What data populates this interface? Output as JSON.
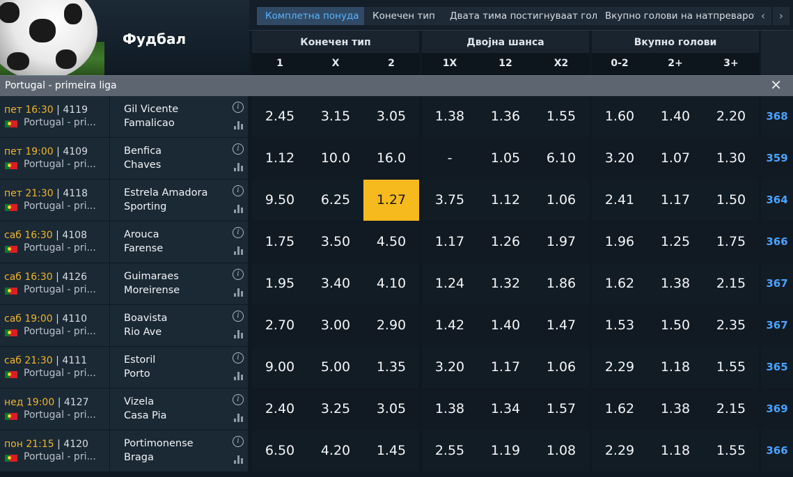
{
  "sport": {
    "title": "Фудбал"
  },
  "tabs": [
    {
      "label": "Комплетна понуда",
      "active": true
    },
    {
      "label": "Конечен тип",
      "active": false
    },
    {
      "label": "Двата тима постигнуваат гол",
      "active": false
    },
    {
      "label": "Вкупно голови на натпреварот",
      "active": false
    }
  ],
  "nav": {
    "prev": "‹",
    "next": "›"
  },
  "groups": [
    {
      "title": "Конечен тип",
      "cols": [
        "1",
        "X",
        "2"
      ]
    },
    {
      "title": "Двојна шанса",
      "cols": [
        "1X",
        "12",
        "X2"
      ]
    },
    {
      "title": "Вкупно голови",
      "cols": [
        "0-2",
        "2+",
        "3+"
      ]
    }
  ],
  "league": {
    "name": "Portugal - primeira liga",
    "close": "✕"
  },
  "colors": {
    "highlight": "#f7ba1e",
    "time": "#f0b52c",
    "more": "#4aa3ff"
  },
  "matches": [
    {
      "day": "пет 16:30",
      "code": "4119",
      "league": "Portugal - pri...",
      "home": "Gil Vicente",
      "away": "Famalicao",
      "odds": [
        "2.45",
        "3.15",
        "3.05",
        "1.38",
        "1.36",
        "1.55",
        "1.60",
        "1.40",
        "2.20"
      ],
      "more": "368",
      "highlight": -1
    },
    {
      "day": "пет 19:00",
      "code": "4109",
      "league": "Portugal - pri...",
      "home": "Benfica",
      "away": "Chaves",
      "odds": [
        "1.12",
        "10.0",
        "16.0",
        "-",
        "1.05",
        "6.10",
        "3.20",
        "1.07",
        "1.30"
      ],
      "more": "359",
      "highlight": -1
    },
    {
      "day": "пет 21:30",
      "code": "4118",
      "league": "Portugal - pri...",
      "home": "Estrela Amadora",
      "away": "Sporting",
      "odds": [
        "9.50",
        "6.25",
        "1.27",
        "3.75",
        "1.12",
        "1.06",
        "2.41",
        "1.17",
        "1.50"
      ],
      "more": "364",
      "highlight": 2
    },
    {
      "day": "саб 16:30",
      "code": "4108",
      "league": "Portugal - pri...",
      "home": "Arouca",
      "away": "Farense",
      "odds": [
        "1.75",
        "3.50",
        "4.50",
        "1.17",
        "1.26",
        "1.97",
        "1.96",
        "1.25",
        "1.75"
      ],
      "more": "366",
      "highlight": -1
    },
    {
      "day": "саб 16:30",
      "code": "4126",
      "league": "Portugal - pri...",
      "home": "Guimaraes",
      "away": "Moreirense",
      "odds": [
        "1.95",
        "3.40",
        "4.10",
        "1.24",
        "1.32",
        "1.86",
        "1.62",
        "1.38",
        "2.15"
      ],
      "more": "367",
      "highlight": -1
    },
    {
      "day": "саб 19:00",
      "code": "4110",
      "league": "Portugal - pri...",
      "home": "Boavista",
      "away": "Rio Ave",
      "odds": [
        "2.70",
        "3.00",
        "2.90",
        "1.42",
        "1.40",
        "1.47",
        "1.53",
        "1.50",
        "2.35"
      ],
      "more": "367",
      "highlight": -1
    },
    {
      "day": "саб 21:30",
      "code": "4111",
      "league": "Portugal - pri...",
      "home": "Estoril",
      "away": "Porto",
      "odds": [
        "9.00",
        "5.00",
        "1.35",
        "3.20",
        "1.17",
        "1.06",
        "2.29",
        "1.18",
        "1.55"
      ],
      "more": "365",
      "highlight": -1
    },
    {
      "day": "нед 19:00",
      "code": "4127",
      "league": "Portugal - pri...",
      "home": "Vizela",
      "away": "Casa Pia",
      "odds": [
        "2.40",
        "3.25",
        "3.05",
        "1.38",
        "1.34",
        "1.57",
        "1.62",
        "1.38",
        "2.15"
      ],
      "more": "369",
      "highlight": -1
    },
    {
      "day": "пон 21:15",
      "code": "4120",
      "league": "Portugal - pri...",
      "home": "Portimonense",
      "away": "Braga",
      "odds": [
        "6.50",
        "4.20",
        "1.45",
        "2.55",
        "1.19",
        "1.08",
        "2.29",
        "1.18",
        "1.55"
      ],
      "more": "366",
      "highlight": -1
    }
  ]
}
